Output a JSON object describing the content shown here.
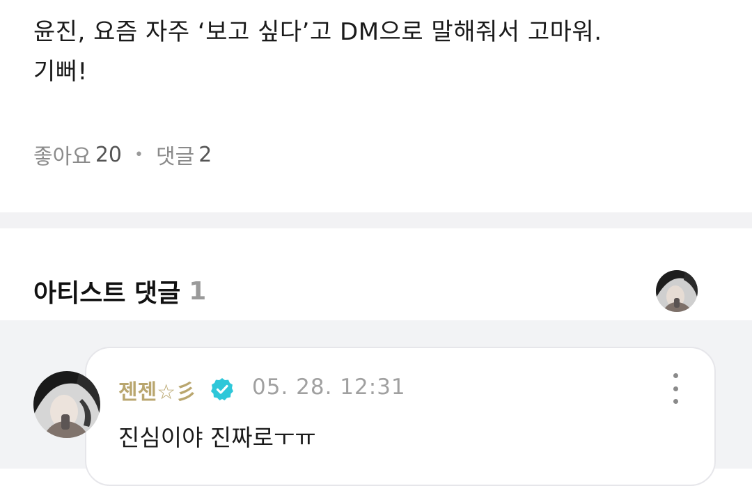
{
  "post": {
    "body_line1": "윤진, 요즘 자주 ‘보고 싶다’고 DM으로 말해줘서 고마워.",
    "body_line2": "기뻐!",
    "likes_label": "좋아요",
    "likes_count": "20",
    "comments_label": "댓글",
    "comments_count": "2"
  },
  "artist_comments": {
    "title": "아티스트 댓글",
    "count": "1"
  },
  "comment": {
    "author": "젠젠☆彡",
    "timestamp": "05. 28. 12:31",
    "text": "진심이야 진짜로ㅜㅠ"
  },
  "colors": {
    "author": "#b9a66e",
    "verified_badge": "#2ec7d9",
    "band": "#f2f2f4"
  }
}
